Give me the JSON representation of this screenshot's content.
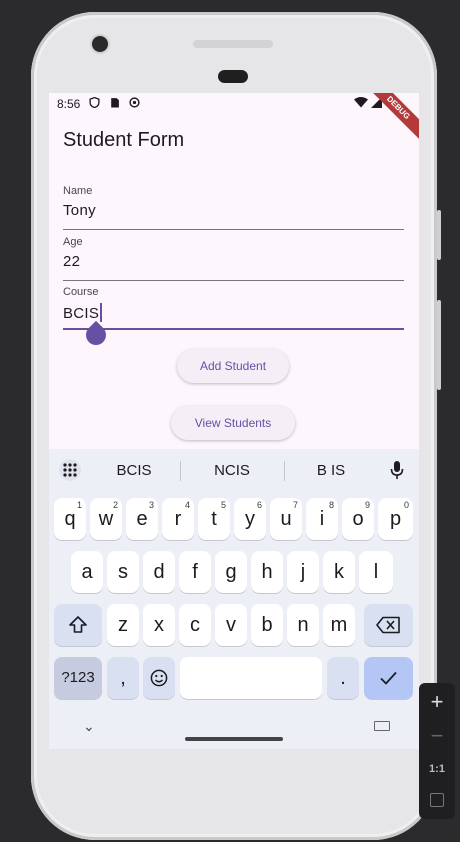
{
  "status_bar": {
    "time": "8:56",
    "debug_label": "DEBUG"
  },
  "app": {
    "title": "Student Form"
  },
  "form": {
    "name": {
      "label": "Name",
      "value": "Tony"
    },
    "age": {
      "label": "Age",
      "value": "22"
    },
    "course": {
      "label": "Course",
      "value": "BCIS"
    }
  },
  "buttons": {
    "add": "Add Student",
    "view": "View Students"
  },
  "keyboard": {
    "suggestions": [
      "BCIS",
      "NCIS",
      "B IS"
    ],
    "row1": [
      {
        "k": "q",
        "n": "1"
      },
      {
        "k": "w",
        "n": "2"
      },
      {
        "k": "e",
        "n": "3"
      },
      {
        "k": "r",
        "n": "4"
      },
      {
        "k": "t",
        "n": "5"
      },
      {
        "k": "y",
        "n": "6"
      },
      {
        "k": "u",
        "n": "7"
      },
      {
        "k": "i",
        "n": "8"
      },
      {
        "k": "o",
        "n": "9"
      },
      {
        "k": "p",
        "n": "0"
      }
    ],
    "row2": [
      "a",
      "s",
      "d",
      "f",
      "g",
      "h",
      "j",
      "k",
      "l"
    ],
    "row3": [
      "z",
      "x",
      "c",
      "v",
      "b",
      "n",
      "m"
    ],
    "numbers_key": "?123",
    "comma": ",",
    "period": "."
  },
  "emulator_controls": {
    "zoom_ratio": "1:1"
  }
}
